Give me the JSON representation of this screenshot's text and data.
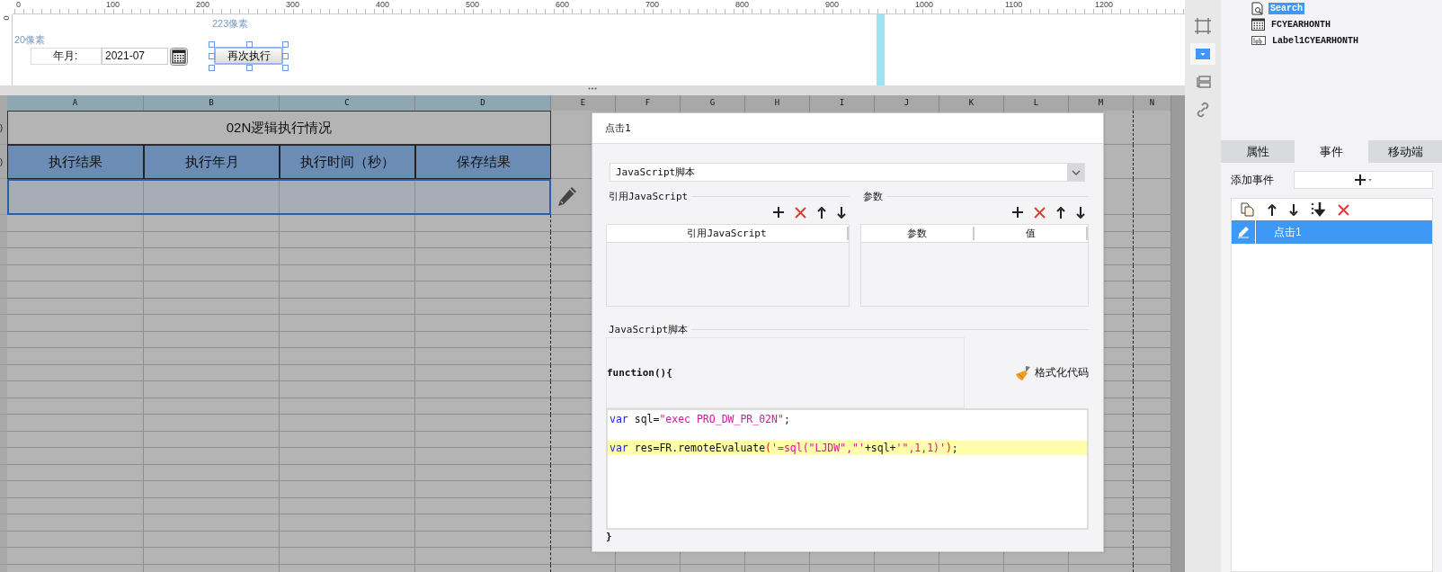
{
  "ruler": {
    "labels": [
      "0",
      "100",
      "200",
      "300",
      "400",
      "500",
      "600",
      "700",
      "800",
      "900",
      "1000",
      "1100",
      "1200"
    ],
    "vertical_labels": [
      "0"
    ]
  },
  "canvas": {
    "spacing_labels": [
      "20像素",
      "223像素"
    ],
    "widgets": [
      {
        "kind": "label",
        "text": "年月:"
      },
      {
        "kind": "date_field",
        "value": "2021-07"
      },
      {
        "kind": "button",
        "label": "再次执行",
        "selected": true
      }
    ]
  },
  "sheet": {
    "columns": [
      "A",
      "B",
      "C",
      "D",
      "E",
      "F",
      "G",
      "H",
      "I",
      "J",
      "K",
      "L",
      "M",
      "N"
    ],
    "row_headers": [
      ")",
      ")"
    ],
    "title": "02N逻辑执行情况",
    "headers": [
      "执行结果",
      "执行年月",
      "执行时间（秒）",
      "保存结果"
    ],
    "data_row": {
      "selected": true
    }
  },
  "dialog": {
    "title": "点击1",
    "action_type": "JavaScript脚本",
    "imports": {
      "legend": "引用JavaScript",
      "columns": [
        "引用JavaScript"
      ]
    },
    "parameters": {
      "legend": "参数",
      "columns": [
        "参数",
        "值"
      ]
    },
    "script": {
      "legend": "JavaScript脚本",
      "header": "function(){",
      "format_button": "格式化代码",
      "footer": "}",
      "lines": [
        {
          "highlighted": false,
          "tokens": [
            {
              "kind": "keyword",
              "text": "var"
            },
            {
              "kind": "plain",
              "text": " sql="
            },
            {
              "kind": "string",
              "text": "\"exec PRO_DW_PR_02N\""
            },
            {
              "kind": "plain",
              "text": ";"
            }
          ]
        },
        {
          "highlighted": false
        },
        {
          "highlighted": true,
          "tokens": [
            {
              "kind": "keyword",
              "text": "var"
            },
            {
              "kind": "plain",
              "text": " res=FR.remoteEvaluate"
            },
            {
              "kind": "paren",
              "text": "("
            },
            {
              "kind": "string",
              "text": "'=sql(\"LJDW\",\"'"
            },
            {
              "kind": "plain",
              "text": "+sql+"
            },
            {
              "kind": "string",
              "text": "'\",1,1)'"
            },
            {
              "kind": "paren",
              "text": ")"
            },
            {
              "kind": "plain",
              "text": ";"
            }
          ]
        }
      ]
    }
  },
  "side_toolbar": [
    {
      "kind": "frame",
      "selected": false
    },
    {
      "kind": "dropdown",
      "selected": true
    },
    {
      "kind": "form",
      "selected": false
    },
    {
      "kind": "link",
      "selected": false
    }
  ],
  "widget_tree": [
    {
      "kind": "search",
      "label": "Search",
      "selected": true
    },
    {
      "kind": "date",
      "label": "FCYEARHONTH",
      "selected": false
    },
    {
      "kind": "label",
      "label": "Label1CYEARHONTH",
      "selected": false
    }
  ],
  "panel_tabs": [
    {
      "label": "属性",
      "selected": false
    },
    {
      "label": "事件",
      "selected": true
    },
    {
      "label": "移动端",
      "selected": false
    }
  ],
  "events": {
    "add_label": "添加事件",
    "items": [
      {
        "label": "点击1",
        "selected": true
      }
    ]
  }
}
